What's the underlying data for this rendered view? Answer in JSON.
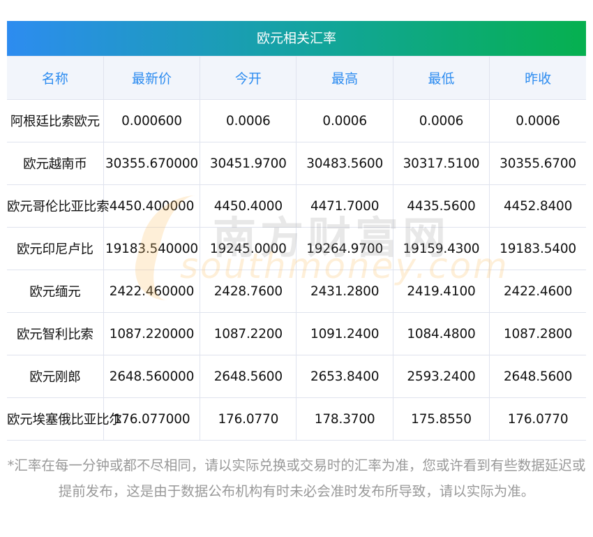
{
  "title": "欧元相关汇率",
  "columns": [
    "名称",
    "最新价",
    "今开",
    "最高",
    "最低",
    "昨收"
  ],
  "rows": [
    [
      "阿根廷比索欧元",
      "0.000600",
      "0.0006",
      "0.0006",
      "0.0006",
      "0.0006"
    ],
    [
      "欧元越南币",
      "30355.670000",
      "30451.9700",
      "30483.5600",
      "30317.5100",
      "30355.6700"
    ],
    [
      "欧元哥伦比亚比索",
      "4450.400000",
      "4450.4000",
      "4471.7000",
      "4435.5600",
      "4452.8400"
    ],
    [
      "欧元印尼卢比",
      "19183.540000",
      "19245.0000",
      "19264.9700",
      "19159.4300",
      "19183.5400"
    ],
    [
      "欧元缅元",
      "2422.460000",
      "2428.7600",
      "2431.2800",
      "2419.4100",
      "2422.4600"
    ],
    [
      "欧元智利比索",
      "1087.220000",
      "1087.2200",
      "1091.2400",
      "1084.4800",
      "1087.2800"
    ],
    [
      "欧元刚郎",
      "2648.560000",
      "2648.5600",
      "2653.8400",
      "2593.2400",
      "2648.5600"
    ],
    [
      "欧元埃塞俄比亚比尔",
      "176.077000",
      "176.0770",
      "178.3700",
      "175.8550",
      "176.0770"
    ]
  ],
  "watermark": {
    "cn": "南方财富网",
    "en": "southmoney.com"
  },
  "note": "*汇率在每一分钟或都不尽相同，请以实际兑换或交易时的汇率为准，您或许看到有些数据延迟或提前发布，这是由于数据公布机构有时未必会准时发布所导致，请以实际为准。"
}
